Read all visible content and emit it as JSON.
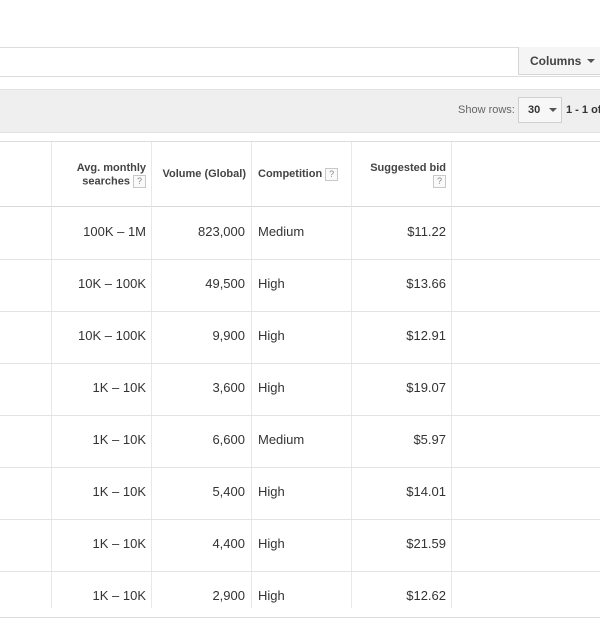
{
  "toolbar": {
    "columns_label": "Columns"
  },
  "pager": {
    "show_rows_label": "Show rows:",
    "rows_value": "30",
    "range_text": "1 - 1 of"
  },
  "table": {
    "headers": {
      "avg_monthly_l1": "Avg. monthly",
      "avg_monthly_l2": "searches",
      "volume": "Volume (Global)",
      "competition": "Competition",
      "suggested_bid": "Suggested bid",
      "help": "?"
    },
    "rows": [
      {
        "avg": "100K – 1M",
        "volume": "823,000",
        "competition": "Medium",
        "bid": "$11.22"
      },
      {
        "avg": "10K – 100K",
        "volume": "49,500",
        "competition": "High",
        "bid": "$13.66"
      },
      {
        "avg": "10K – 100K",
        "volume": "9,900",
        "competition": "High",
        "bid": "$12.91"
      },
      {
        "avg": "1K – 10K",
        "volume": "3,600",
        "competition": "High",
        "bid": "$19.07"
      },
      {
        "avg": "1K – 10K",
        "volume": "6,600",
        "competition": "Medium",
        "bid": "$5.97"
      },
      {
        "avg": "1K – 10K",
        "volume": "5,400",
        "competition": "High",
        "bid": "$14.01"
      },
      {
        "avg": "1K – 10K",
        "volume": "4,400",
        "competition": "High",
        "bid": "$21.59"
      },
      {
        "avg": "1K – 10K",
        "volume": "2,900",
        "competition": "High",
        "bid": "$12.62"
      }
    ]
  }
}
